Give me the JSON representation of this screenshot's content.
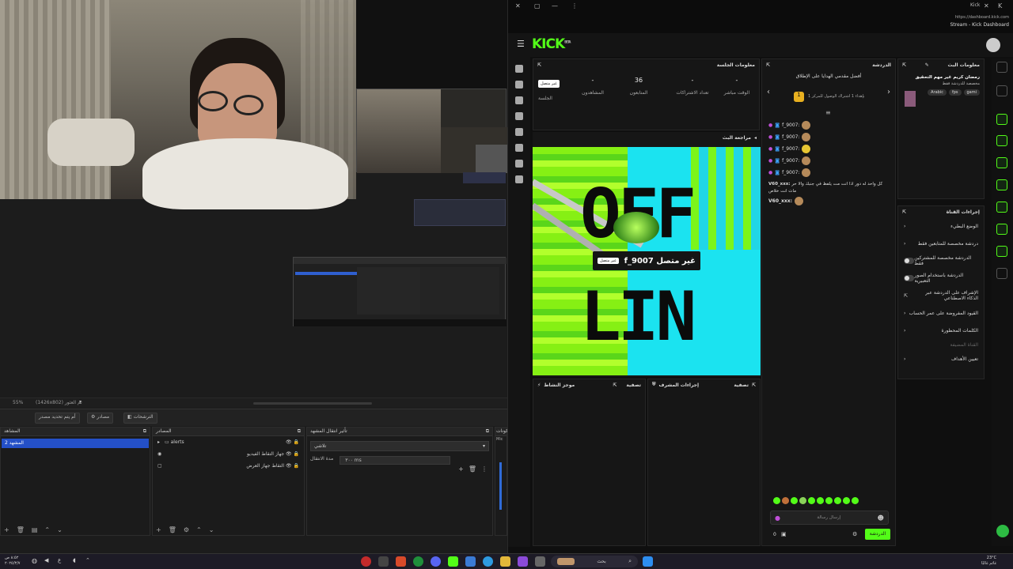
{
  "obs": {
    "preview_zoom": "55%",
    "preview_res": "(1426x802) تم العثور",
    "scene_buttons": [
      "أم يتم تحديد مصدر",
      "مصادر",
      "الترشحات"
    ],
    "scenes_title": "المشاهد",
    "scene_selected": "المشهد 2",
    "sources_title": "المصادر",
    "sources": [
      {
        "name": "alerts",
        "icon": "folder-icon"
      },
      {
        "name": "جهاز التقاط الفيديو",
        "icon": "camera-icon"
      },
      {
        "name": "التقاط جهاز العرض",
        "icon": "monitor-icon"
      }
    ],
    "transitions_title": "تأثير انتقال المشهد",
    "transition_value": "تلاشي",
    "duration_label": "مدة الانتقال",
    "duration_value": "٣٠٠ ms",
    "controls_title": "المكونات",
    "controls_text": "Mic"
  },
  "kick": {
    "url": "https://dashboard.kick.com",
    "window_title": "Stream - Kick Dashboard",
    "app_name": "Kick",
    "logo": "KICK",
    "logo_sup": "BETA",
    "session": {
      "title": "معلومات الجلسة",
      "status_badge": "غير متصل",
      "status_label": "الجلسة",
      "stats": [
        {
          "value": "-",
          "label": "المشاهدون"
        },
        {
          "value": "36",
          "label": "المتابعون"
        },
        {
          "value": "-",
          "label": "تعداد الاشتراكات"
        },
        {
          "value": "-",
          "label": "الوقت مباشر"
        }
      ]
    },
    "preview": {
      "title": "مراجعة البث",
      "overlay_name": "f_9007 غير متصل",
      "overlay_badge": "غير متصل",
      "offline_text_1": "OFF",
      "offline_text_2": "LIN"
    },
    "bottom_panels": [
      {
        "title": "موجز النشاط",
        "action": "تصفية"
      },
      {
        "title": "إجراءات المشرف",
        "action": "تصفية"
      }
    ],
    "chat": {
      "title": "الدردشة",
      "pinned": "أفضل مقدمي الهدايا على الإطلاق",
      "pinned_sub": "بإهداء 1 اشتراك الوصول للمركز 1",
      "rank": "1",
      "messages": [
        {
          "user": "f_9007:",
          "text": ""
        },
        {
          "user": "f_9007:",
          "text": ""
        },
        {
          "user": "f_9007:",
          "text": ""
        },
        {
          "user": "f_9007:",
          "text": ""
        },
        {
          "user": "f_9007:",
          "text": ""
        }
      ],
      "msg_long_user": "V60_xxx:",
      "msg_long_text": "كل واحد له دور اذا انت مت يلفظ في جنبك والا حر",
      "msg_long_text2": "مات انت خلاص",
      "msg_short_user": "V60_xxx:",
      "input_placeholder": "إرسال رسالة",
      "send_label": "الدردشة",
      "count": "0"
    },
    "stream_info": {
      "title": "معلومات البث",
      "stream_title": "رمضان كريم غير مهم التحقيق",
      "category": "مخصصة للدردشة فقط",
      "tags": [
        "Arabic",
        "fps",
        "gami"
      ]
    },
    "channel_actions": {
      "title": "إجراءات القناة",
      "items": [
        {
          "label": "الوضع البطيء",
          "type": "arrow"
        },
        {
          "label": "دردشة مخصصة للمتابعين فقط",
          "type": "arrow"
        },
        {
          "label": "الدردشة مخصصة للمشتركين فقط",
          "type": "toggle"
        },
        {
          "label": "الدردشة باستخدام الصور التعبيرية",
          "type": "toggle"
        },
        {
          "label": "الإشراف على الدردشة عبر الذكاء الاصطناعي",
          "type": "link"
        },
        {
          "label": "القيود المفروضة على عمر الحساب",
          "type": "arrow"
        },
        {
          "label": "الكلمات المحظورة",
          "type": "arrow"
        },
        {
          "label": "القناة المضيفة",
          "type": "muted"
        },
        {
          "label": "تعيين الأهداف",
          "type": "arrow"
        }
      ]
    }
  },
  "taskbar": {
    "search": "بحث",
    "time": "٨:٥٢ ص",
    "date": "٢٠٢٥/٣/٧",
    "lang": "ع",
    "weather_temp": "23°C",
    "weather_text": "غائم غالبًا"
  },
  "colors": {
    "kick_green": "#53fc18",
    "obs_select": "#2450c7"
  }
}
